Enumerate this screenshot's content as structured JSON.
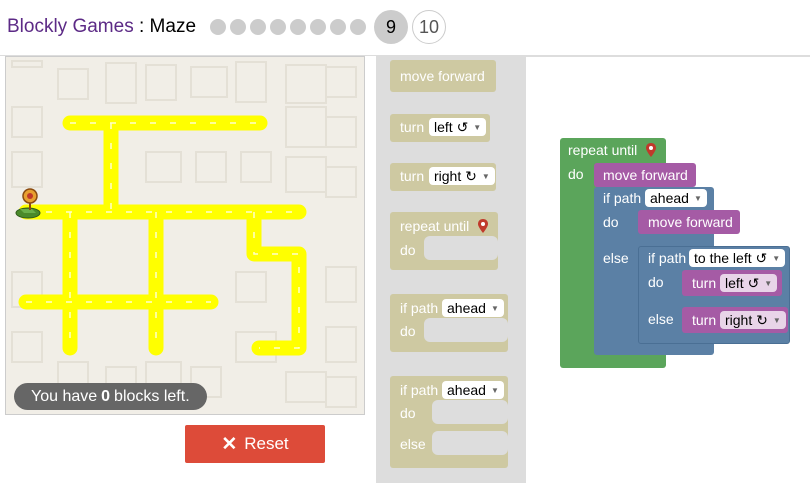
{
  "header": {
    "app_title": "Blockly Games",
    "separator": " : ",
    "game_title": "Maze",
    "levels": {
      "completed_dots": 8,
      "current": "9",
      "next": "10"
    }
  },
  "maze": {
    "capacity_prefix": "You have",
    "capacity_count": "0",
    "capacity_suffix": "blocks left."
  },
  "controls": {
    "reset_label": "Reset"
  },
  "toolbox": {
    "move_forward": "move forward",
    "turn": "turn",
    "left": "left ↺",
    "right": "right ↻",
    "repeat_until": "repeat until",
    "do": "do",
    "if_path": "if path",
    "ahead": "ahead",
    "else": "else"
  },
  "workspace": {
    "repeat_until": "repeat until",
    "do": "do",
    "move_forward_1": "move forward",
    "if_path": "if path",
    "ahead": "ahead",
    "move_forward_2": "move forward",
    "else": "else",
    "if_path_2": "if path",
    "to_the_left": "to the left ↺",
    "turn_left": "turn",
    "left": "left ↺",
    "turn_right": "turn",
    "right": "right ↻"
  },
  "colors": {
    "brand": "#5c2a86",
    "reset": "#dd4b39",
    "loop_block": "#5ba55b",
    "action_block": "#a55ba5",
    "logic_block": "#5b80a5",
    "toolbox_ghost": "#ccc79e",
    "maze_path": "#ffff00"
  }
}
